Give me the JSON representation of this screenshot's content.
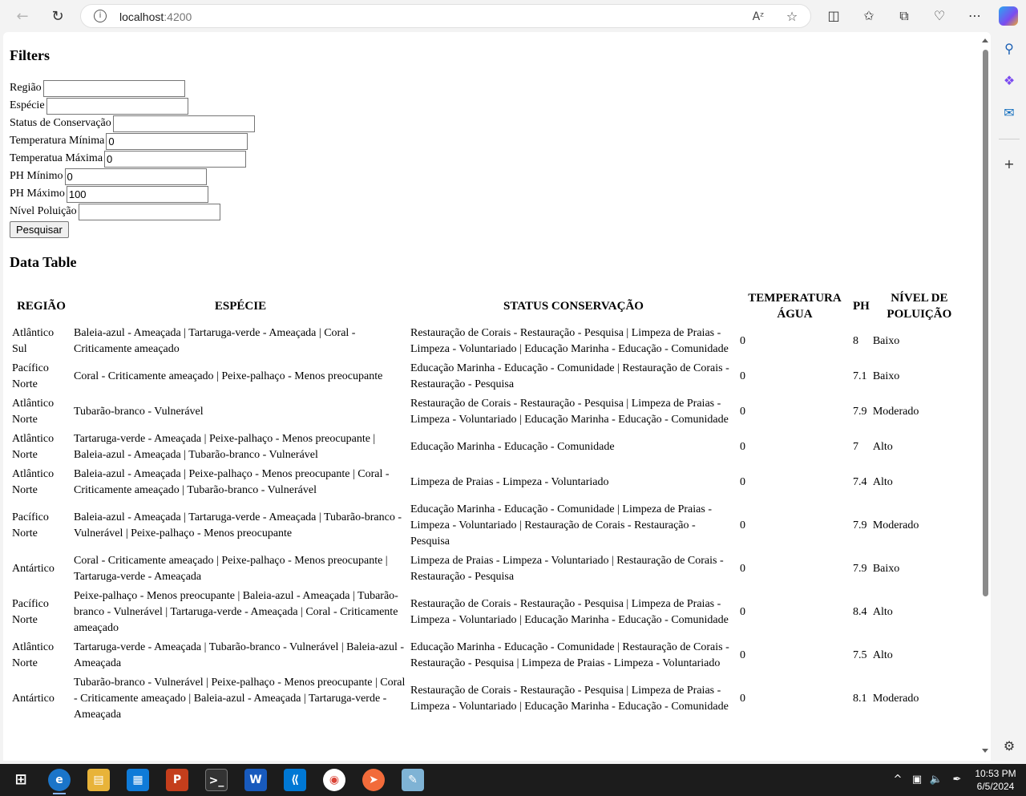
{
  "browser": {
    "url_host": "localhost",
    "url_port": ":4200"
  },
  "filters": {
    "title": "Filters",
    "fields": [
      {
        "label": "Região",
        "value": ""
      },
      {
        "label": "Espécie",
        "value": ""
      },
      {
        "label": "Status de Conservação",
        "value": ""
      },
      {
        "label": "Temperatura Mínima",
        "value": "0"
      },
      {
        "label": "Temperatua Máxima",
        "value": "0"
      },
      {
        "label": "PH Mínimo",
        "value": "0"
      },
      {
        "label": "PH Máximo",
        "value": "100"
      },
      {
        "label": "Nível Poluição",
        "value": ""
      }
    ],
    "search_label": "Pesquisar"
  },
  "table": {
    "title": "Data Table",
    "headers": [
      "Região",
      "Espécie",
      "Status Conservação",
      "Temperatura Água",
      "PH",
      "Nível de Poluição"
    ],
    "rows": [
      [
        "Atlântico Sul",
        "Baleia-azul - Ameaçada | Tartaruga-verde - Ameaçada | Coral - Criticamente ameaçado",
        "Restauração de Corais - Restauração - Pesquisa | Limpeza de Praias - Limpeza - Voluntariado | Educação Marinha - Educação - Comunidade",
        "0",
        "8",
        "Baixo"
      ],
      [
        "Pacífico Norte",
        "Coral - Criticamente ameaçado | Peixe-palhaço - Menos preocupante",
        "Educação Marinha - Educação - Comunidade | Restauração de Corais - Restauração - Pesquisa",
        "0",
        "7.1",
        "Baixo"
      ],
      [
        "Atlântico Norte",
        "Tubarão-branco - Vulnerável",
        "Restauração de Corais - Restauração - Pesquisa | Limpeza de Praias - Limpeza - Voluntariado | Educação Marinha - Educação - Comunidade",
        "0",
        "7.9",
        "Moderado"
      ],
      [
        "Atlântico Norte",
        "Tartaruga-verde - Ameaçada | Peixe-palhaço - Menos preocupante | Baleia-azul - Ameaçada | Tubarão-branco - Vulnerável",
        "Educação Marinha - Educação - Comunidade",
        "0",
        "7",
        "Alto"
      ],
      [
        "Atlântico Norte",
        "Baleia-azul - Ameaçada | Peixe-palhaço - Menos preocupante | Coral - Criticamente ameaçado | Tubarão-branco - Vulnerável",
        "Limpeza de Praias - Limpeza - Voluntariado",
        "0",
        "7.4",
        "Alto"
      ],
      [
        "Pacífico Norte",
        "Baleia-azul - Ameaçada | Tartaruga-verde - Ameaçada | Tubarão-branco - Vulnerável | Peixe-palhaço - Menos preocupante",
        "Educação Marinha - Educação - Comunidade | Limpeza de Praias - Limpeza - Voluntariado | Restauração de Corais - Restauração - Pesquisa",
        "0",
        "7.9",
        "Moderado"
      ],
      [
        "Antártico",
        "Coral - Criticamente ameaçado | Peixe-palhaço - Menos preocupante | Tartaruga-verde - Ameaçada",
        "Limpeza de Praias - Limpeza - Voluntariado | Restauração de Corais - Restauração - Pesquisa",
        "0",
        "7.9",
        "Baixo"
      ],
      [
        "Pacífico Norte",
        "Peixe-palhaço - Menos preocupante | Baleia-azul - Ameaçada | Tubarão-branco - Vulnerável | Tartaruga-verde - Ameaçada | Coral - Criticamente ameaçado",
        "Restauração de Corais - Restauração - Pesquisa | Limpeza de Praias - Limpeza - Voluntariado | Educação Marinha - Educação - Comunidade",
        "0",
        "8.4",
        "Alto"
      ],
      [
        "Atlântico Norte",
        "Tartaruga-verde - Ameaçada | Tubarão-branco - Vulnerável | Baleia-azul - Ameaçada",
        "Educação Marinha - Educação - Comunidade | Restauração de Corais - Restauração - Pesquisa | Limpeza de Praias - Limpeza - Voluntariado",
        "0",
        "7.5",
        "Alto"
      ],
      [
        "Antártico",
        "Tubarão-branco - Vulnerável | Peixe-palhaço - Menos preocupante | Coral - Criticamente ameaçado | Baleia-azul - Ameaçada | Tartaruga-verde - Ameaçada",
        "Restauração de Corais - Restauração - Pesquisa | Limpeza de Praias - Limpeza - Voluntariado | Educação Marinha - Educação - Comunidade",
        "0",
        "8.1",
        "Moderado"
      ]
    ]
  },
  "taskbar": {
    "time": "10:53 PM",
    "date": "6/5/2024"
  },
  "icons": {
    "back": "back-arrow-icon",
    "refresh": "refresh-icon",
    "info": "info-icon",
    "read_aloud": "read-aloud-icon",
    "favorite": "star-icon",
    "split": "split-screen-icon",
    "favorites": "favorites-icon",
    "collections": "collections-icon",
    "performance": "heartbeat-icon",
    "more": "more-icon",
    "copilot": "copilot-icon"
  }
}
